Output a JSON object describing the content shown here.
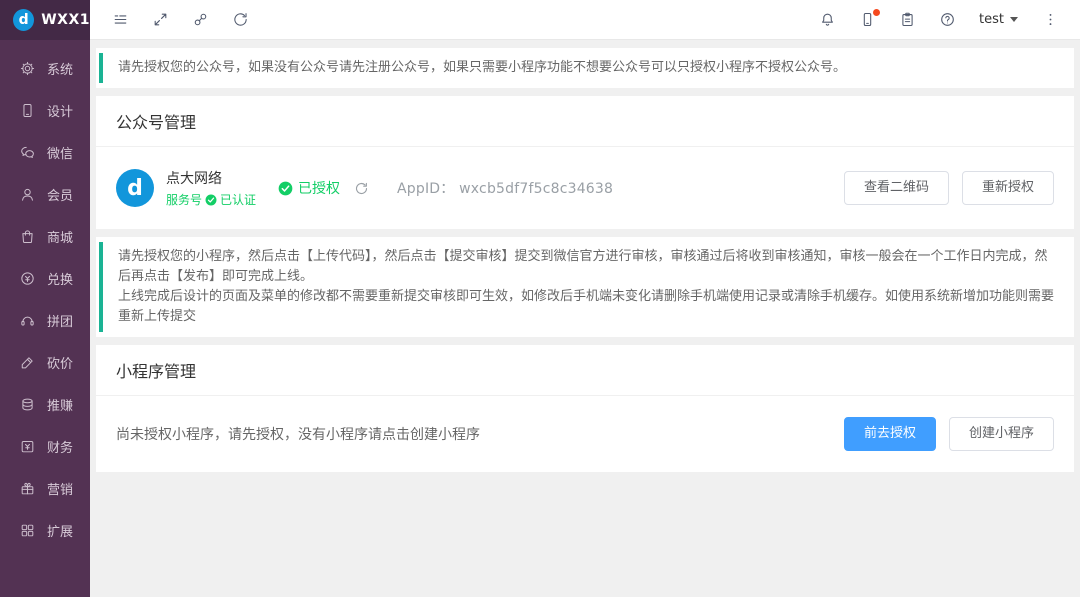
{
  "app": {
    "name": "WXX1",
    "logo_letter": "d"
  },
  "colors": {
    "sidebar_bg": "#533253",
    "sidebar_top_bg": "#432946",
    "logo_blue": "#1296db",
    "alert_accent_teal": "#1ab394",
    "success_green": "#13ce66",
    "primary_blue": "#409eff",
    "notification_dot": "#f5491f",
    "content_bg": "#f0f0f0"
  },
  "sidebar": {
    "items": [
      {
        "icon": "gear-icon",
        "label": "系统"
      },
      {
        "icon": "mobile-icon",
        "label": "设计"
      },
      {
        "icon": "wechat-icon",
        "label": "微信"
      },
      {
        "icon": "member-icon",
        "label": "会员"
      },
      {
        "icon": "mall-icon",
        "label": "商城"
      },
      {
        "icon": "exchange-icon",
        "label": "兑换"
      },
      {
        "icon": "groupon-icon",
        "label": "拼团"
      },
      {
        "icon": "bargain-icon",
        "label": "砍价"
      },
      {
        "icon": "earn-icon",
        "label": "推赚"
      },
      {
        "icon": "finance-icon",
        "label": "财务"
      },
      {
        "icon": "marketing-icon",
        "label": "营销"
      },
      {
        "icon": "extension-icon",
        "label": "扩展"
      }
    ]
  },
  "topbar": {
    "user": "test"
  },
  "alerts": {
    "official": "请先授权您的公众号，如果没有公众号请先注册公众号，如果只需要小程序功能不想要公众号可以只授权小程序不授权公众号。",
    "mini_line1": "请先授权您的小程序，然后点击【上传代码】，然后点击【提交审核】提交到微信官方进行审核，审核通过后将收到审核通知，审核一般会在一个工作日内完成，然后再点击【发布】即可完成上线。",
    "mini_line2": "上线完成后设计的页面及菜单的修改都不需要重新提交审核即可生效，如修改后手机端未变化请删除手机端使用记录或清除手机缓存。如使用系统新增加功能则需要重新上传提交"
  },
  "official_account": {
    "title": "公众号管理",
    "avatar_letter": "d",
    "name": "点大网络",
    "type_label": "服务号",
    "verified_label": "已认证",
    "authorized_label": "已授权",
    "appid_label": "AppID：",
    "appid_value": "wxcb5df7f5c8c34638",
    "qr_button": "查看二维码",
    "reauth_button": "重新授权"
  },
  "mini_program": {
    "title": "小程序管理",
    "empty_text": "尚未授权小程序，请先授权，没有小程序请点击创建小程序",
    "auth_button": "前去授权",
    "create_button": "创建小程序"
  }
}
